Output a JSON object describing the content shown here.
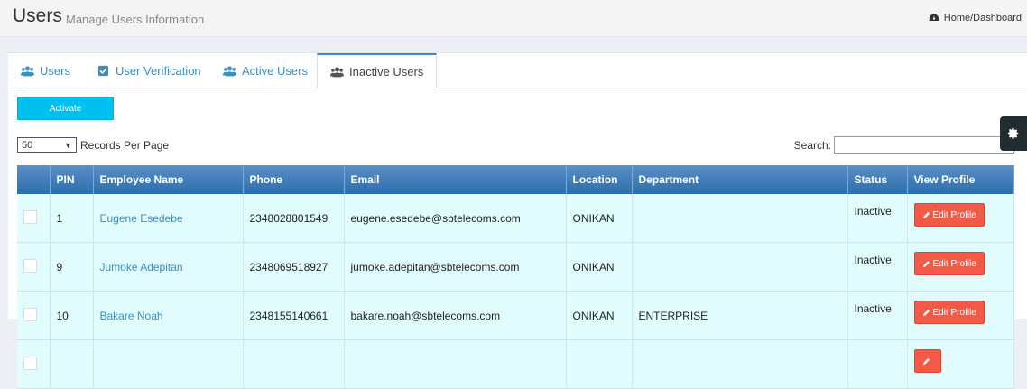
{
  "header": {
    "title": "Users",
    "subtitle": "Manage Users Information",
    "breadcrumb": "Home/Dashboard"
  },
  "tabs": [
    {
      "label": "Users",
      "icon": "users-icon"
    },
    {
      "label": "User Verification",
      "icon": "check-square-icon"
    },
    {
      "label": "Active Users",
      "icon": "users-icon"
    },
    {
      "label": "Inactive Users",
      "icon": "users-icon",
      "active": true
    }
  ],
  "toolbar": {
    "activate_label": "Activate"
  },
  "records": {
    "selected": "50",
    "label": "Records Per Page"
  },
  "search": {
    "label": "Search:",
    "value": ""
  },
  "table": {
    "headers": [
      "",
      "PIN",
      "Employee Name",
      "Phone",
      "Email",
      "Location",
      "Department",
      "Status",
      "View Profile"
    ],
    "rows": [
      {
        "pin": "1",
        "name": "Eugene Esedebe",
        "phone": "2348028801549",
        "email": "eugene.esedebe@sbtelecoms.com",
        "location": "ONIKAN",
        "department": "",
        "status": "Inactive",
        "action": "Edit Profile"
      },
      {
        "pin": "9",
        "name": "Jumoke Adepitan",
        "phone": "2348069518927",
        "email": "jumoke.adepitan@sbtelecoms.com",
        "location": "ONIKAN",
        "department": "",
        "status": "Inactive",
        "action": "Edit Profile"
      },
      {
        "pin": "10",
        "name": "Bakare Noah",
        "phone": "2348155140661",
        "email": "bakare.noah@sbtelecoms.com",
        "location": "ONIKAN",
        "department": "ENTERPRISE",
        "status": "Inactive",
        "action": "Edit Profile"
      },
      {
        "pin": "",
        "name": "",
        "phone": "",
        "email": "",
        "location": "",
        "department": "",
        "status": "",
        "action": ""
      }
    ]
  },
  "colors": {
    "accent": "#3c8dbc",
    "activate": "#00c0ef",
    "edit": "#f25a45",
    "row_bg": "#e1fcfd"
  }
}
